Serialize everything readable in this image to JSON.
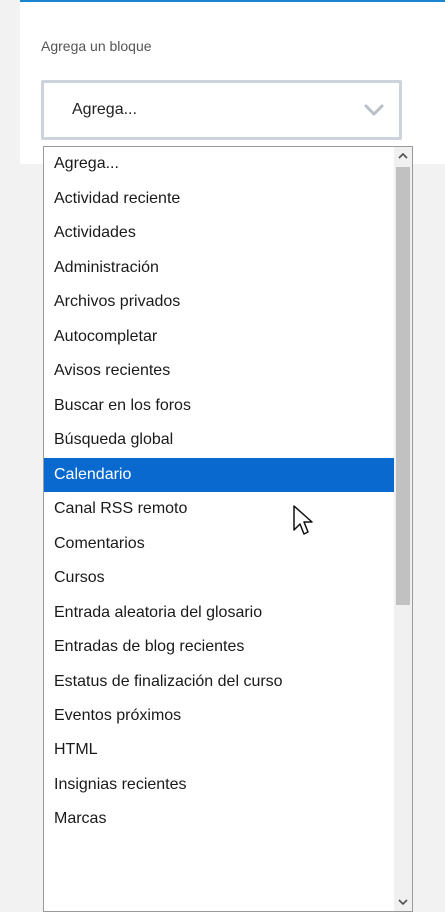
{
  "block": {
    "label": "Agrega un bloque",
    "select_value": "Agrega..."
  },
  "dropdown": {
    "selected_index": 9,
    "options": [
      "Agrega...",
      "Actividad reciente",
      "Actividades",
      "Administración",
      "Archivos privados",
      "Autocompletar",
      "Avisos recientes",
      "Buscar en los foros",
      "Búsqueda global",
      "Calendario",
      "Canal RSS remoto",
      "Comentarios",
      "Cursos",
      "Entrada aleatoria del glosario",
      "Entradas de blog recientes",
      "Estatus de finalización del curso",
      "Eventos próximos",
      "HTML",
      "Insignias recientes",
      "Marcas"
    ]
  },
  "colors": {
    "accent": "#1a86d0",
    "selected_bg": "#0a69ce"
  },
  "icons": {
    "select": "chevron-down-icon",
    "scroll_up": "scroll-up-arrow-icon",
    "scroll_down": "scroll-down-arrow-icon",
    "pointer": "mouse-pointer-icon"
  }
}
